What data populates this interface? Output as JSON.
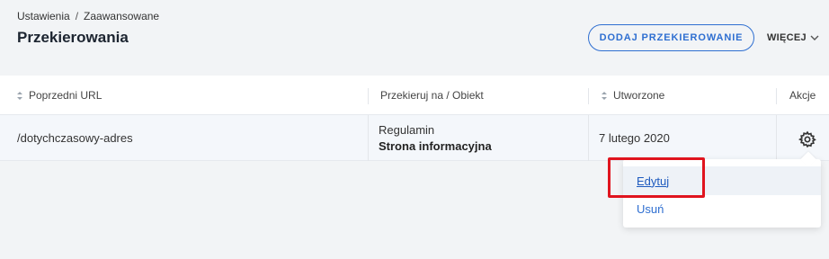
{
  "breadcrumb": {
    "items": [
      "Ustawienia",
      "Zaawansowane"
    ],
    "separator": "/"
  },
  "page_title": "Przekierowania",
  "header": {
    "add_button_label": "DODAJ PRZEKIEROWANIE",
    "more_label": "WIĘCEJ"
  },
  "table": {
    "columns": [
      "Poprzedni URL",
      "Przekieruj na / Obiekt",
      "Utworzone",
      "Akcje"
    ],
    "rows": [
      {
        "previous_url": "/dotychczasowy-adres",
        "redirect_title": "Regulamin",
        "redirect_type": "Strona informacyjna",
        "created": "7 lutego 2020"
      }
    ]
  },
  "actions_menu": {
    "items": [
      "Edytuj",
      "Usuń"
    ]
  },
  "colors": {
    "accent": "#2f6fd1",
    "highlight": "#e0141e"
  }
}
